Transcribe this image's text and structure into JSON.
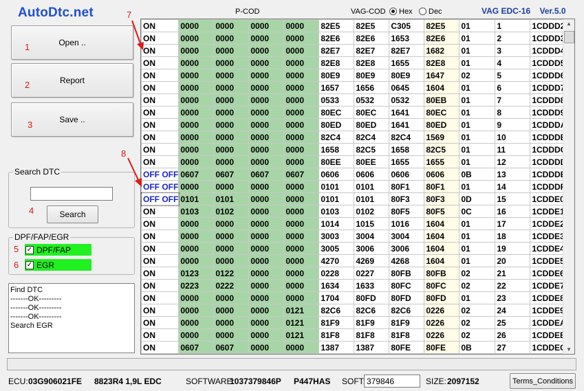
{
  "app": {
    "logo": "AutoDtc.net",
    "title_right": "VAG EDC-16    Ver.5.0"
  },
  "colors": {
    "accent": "#1f4fd8",
    "marker_red": "#e01818",
    "green_col": "#a8d5a8",
    "checkbox_green": "#21f021",
    "off_text": "#1a23c8"
  },
  "buttons": {
    "open": "Open ..",
    "report": "Report",
    "save": "Save ..",
    "search": "Search",
    "terms": "Terms_Conditions"
  },
  "markers": {
    "m1": "1",
    "m2": "2",
    "m3": "3",
    "m4": "4",
    "m5": "5",
    "m6": "6",
    "m7": "7",
    "m8": "8"
  },
  "search_group": {
    "title": "Search DTC",
    "value": ""
  },
  "dpf_group": {
    "title": "DPF/FAP/EGR",
    "dpf_label": "DPF/FAP",
    "egr_label": "EGR",
    "dpf_checked": "✓",
    "egr_checked": "✓"
  },
  "log": {
    "lines": [
      "Find DTC",
      "-------OK---------",
      "-------OK---------",
      "-------OK---------",
      "Search EGR"
    ]
  },
  "header": {
    "pcod": "P-COD",
    "vagcod": "VAG-COD",
    "hex": "Hex",
    "dec": "Dec"
  },
  "grid": {
    "rows": [
      [
        "ON",
        "0000",
        "0000",
        "0000",
        "0000",
        "82E5",
        "82E5",
        "C305",
        "82E5",
        "01",
        "1",
        "1CDDD2"
      ],
      [
        "ON",
        "0000",
        "0000",
        "0000",
        "0000",
        "82E6",
        "82E6",
        "1653",
        "82E6",
        "01",
        "2",
        "1CDDD3"
      ],
      [
        "ON",
        "0000",
        "0000",
        "0000",
        "0000",
        "82E7",
        "82E7",
        "82E7",
        "1682",
        "01",
        "3",
        "1CDDD4"
      ],
      [
        "ON",
        "0000",
        "0000",
        "0000",
        "0000",
        "82E8",
        "82E8",
        "1655",
        "82E8",
        "01",
        "4",
        "1CDDD5"
      ],
      [
        "ON",
        "0000",
        "0000",
        "0000",
        "0000",
        "80E9",
        "80E9",
        "80E9",
        "1647",
        "02",
        "5",
        "1CDDD6"
      ],
      [
        "ON",
        "0000",
        "0000",
        "0000",
        "0000",
        "1657",
        "1656",
        "0645",
        "1604",
        "01",
        "6",
        "1CDDD7"
      ],
      [
        "ON",
        "0000",
        "0000",
        "0000",
        "0000",
        "0533",
        "0532",
        "0532",
        "80EB",
        "01",
        "7",
        "1CDDD8"
      ],
      [
        "ON",
        "0000",
        "0000",
        "0000",
        "0000",
        "80EC",
        "80EC",
        "1641",
        "80EC",
        "01",
        "8",
        "1CDDD9"
      ],
      [
        "ON",
        "0000",
        "0000",
        "0000",
        "0000",
        "80ED",
        "80ED",
        "1641",
        "80ED",
        "01",
        "9",
        "1CDDDA"
      ],
      [
        "ON",
        "0000",
        "0000",
        "0000",
        "0000",
        "82C4",
        "82C4",
        "82C4",
        "1569",
        "01",
        "10",
        "1CDDDB"
      ],
      [
        "ON",
        "0000",
        "0000",
        "0000",
        "0000",
        "1658",
        "82C5",
        "1658",
        "82C5",
        "01",
        "11",
        "1CDDDC"
      ],
      [
        "ON",
        "0000",
        "0000",
        "0000",
        "0000",
        "80EE",
        "80EE",
        "1655",
        "1655",
        "01",
        "12",
        "1CDDDD"
      ],
      [
        "OFF OFF",
        "0607",
        "0607",
        "0607",
        "0607",
        "0606",
        "0606",
        "0606",
        "0606",
        "0B",
        "13",
        "1CDDDE"
      ],
      [
        "OFF OFF",
        "0000",
        "0000",
        "0000",
        "0000",
        "0101",
        "0101",
        "80F1",
        "80F1",
        "01",
        "14",
        "1CDDDF"
      ],
      [
        "OFF OFF",
        "0101",
        "0101",
        "0000",
        "0000",
        "0101",
        "0101",
        "80F3",
        "80F3",
        "0D",
        "15",
        "1CDDE0"
      ],
      [
        "ON",
        "0103",
        "0102",
        "0000",
        "0000",
        "0103",
        "0102",
        "80F5",
        "80F5",
        "0C",
        "16",
        "1CDDE1"
      ],
      [
        "ON",
        "0000",
        "0000",
        "0000",
        "0000",
        "1014",
        "1015",
        "1016",
        "1604",
        "01",
        "17",
        "1CDDE2"
      ],
      [
        "ON",
        "0000",
        "0000",
        "0000",
        "0000",
        "3003",
        "3004",
        "3004",
        "1604",
        "01",
        "18",
        "1CDDE3"
      ],
      [
        "ON",
        "0000",
        "0000",
        "0000",
        "0000",
        "3005",
        "3006",
        "3006",
        "1604",
        "01",
        "19",
        "1CDDE4"
      ],
      [
        "ON",
        "0000",
        "0000",
        "0000",
        "0000",
        "4270",
        "4269",
        "4268",
        "1604",
        "01",
        "20",
        "1CDDE5"
      ],
      [
        "ON",
        "0123",
        "0122",
        "0000",
        "0000",
        "0228",
        "0227",
        "80FB",
        "80FB",
        "02",
        "21",
        "1CDDE6"
      ],
      [
        "ON",
        "0223",
        "0222",
        "0000",
        "0000",
        "1634",
        "1633",
        "80FC",
        "80FC",
        "02",
        "22",
        "1CDDE7"
      ],
      [
        "ON",
        "0000",
        "0000",
        "0000",
        "0000",
        "1704",
        "80FD",
        "80FD",
        "80FD",
        "01",
        "23",
        "1CDDE8"
      ],
      [
        "ON",
        "0000",
        "0000",
        "0000",
        "0121",
        "82C6",
        "82C6",
        "82C6",
        "0226",
        "02",
        "24",
        "1CDDE9"
      ],
      [
        "ON",
        "0000",
        "0000",
        "0000",
        "0121",
        "81F9",
        "81F9",
        "81F9",
        "0226",
        "02",
        "25",
        "1CDDEA"
      ],
      [
        "ON",
        "0000",
        "0000",
        "0000",
        "0121",
        "81F8",
        "81F8",
        "81F8",
        "0226",
        "02",
        "26",
        "1CDDEB"
      ],
      [
        "ON",
        "0607",
        "0607",
        "0000",
        "0000",
        "1387",
        "1387",
        "80FE",
        "80FE",
        "0B",
        "27",
        "1CDDEC"
      ]
    ]
  },
  "status": {
    "ecu_label": "ECU:",
    "ecu_value": "03G906021FE",
    "engine": "8823R4 1,9L EDC",
    "software_label": "SOFTWARE:",
    "software_value": "1037379846P",
    "pcode": "P447HAS",
    "soft_label": "SOFT:",
    "soft_value": "379846",
    "size_label": "SIZE:",
    "size_value": "2097152"
  }
}
